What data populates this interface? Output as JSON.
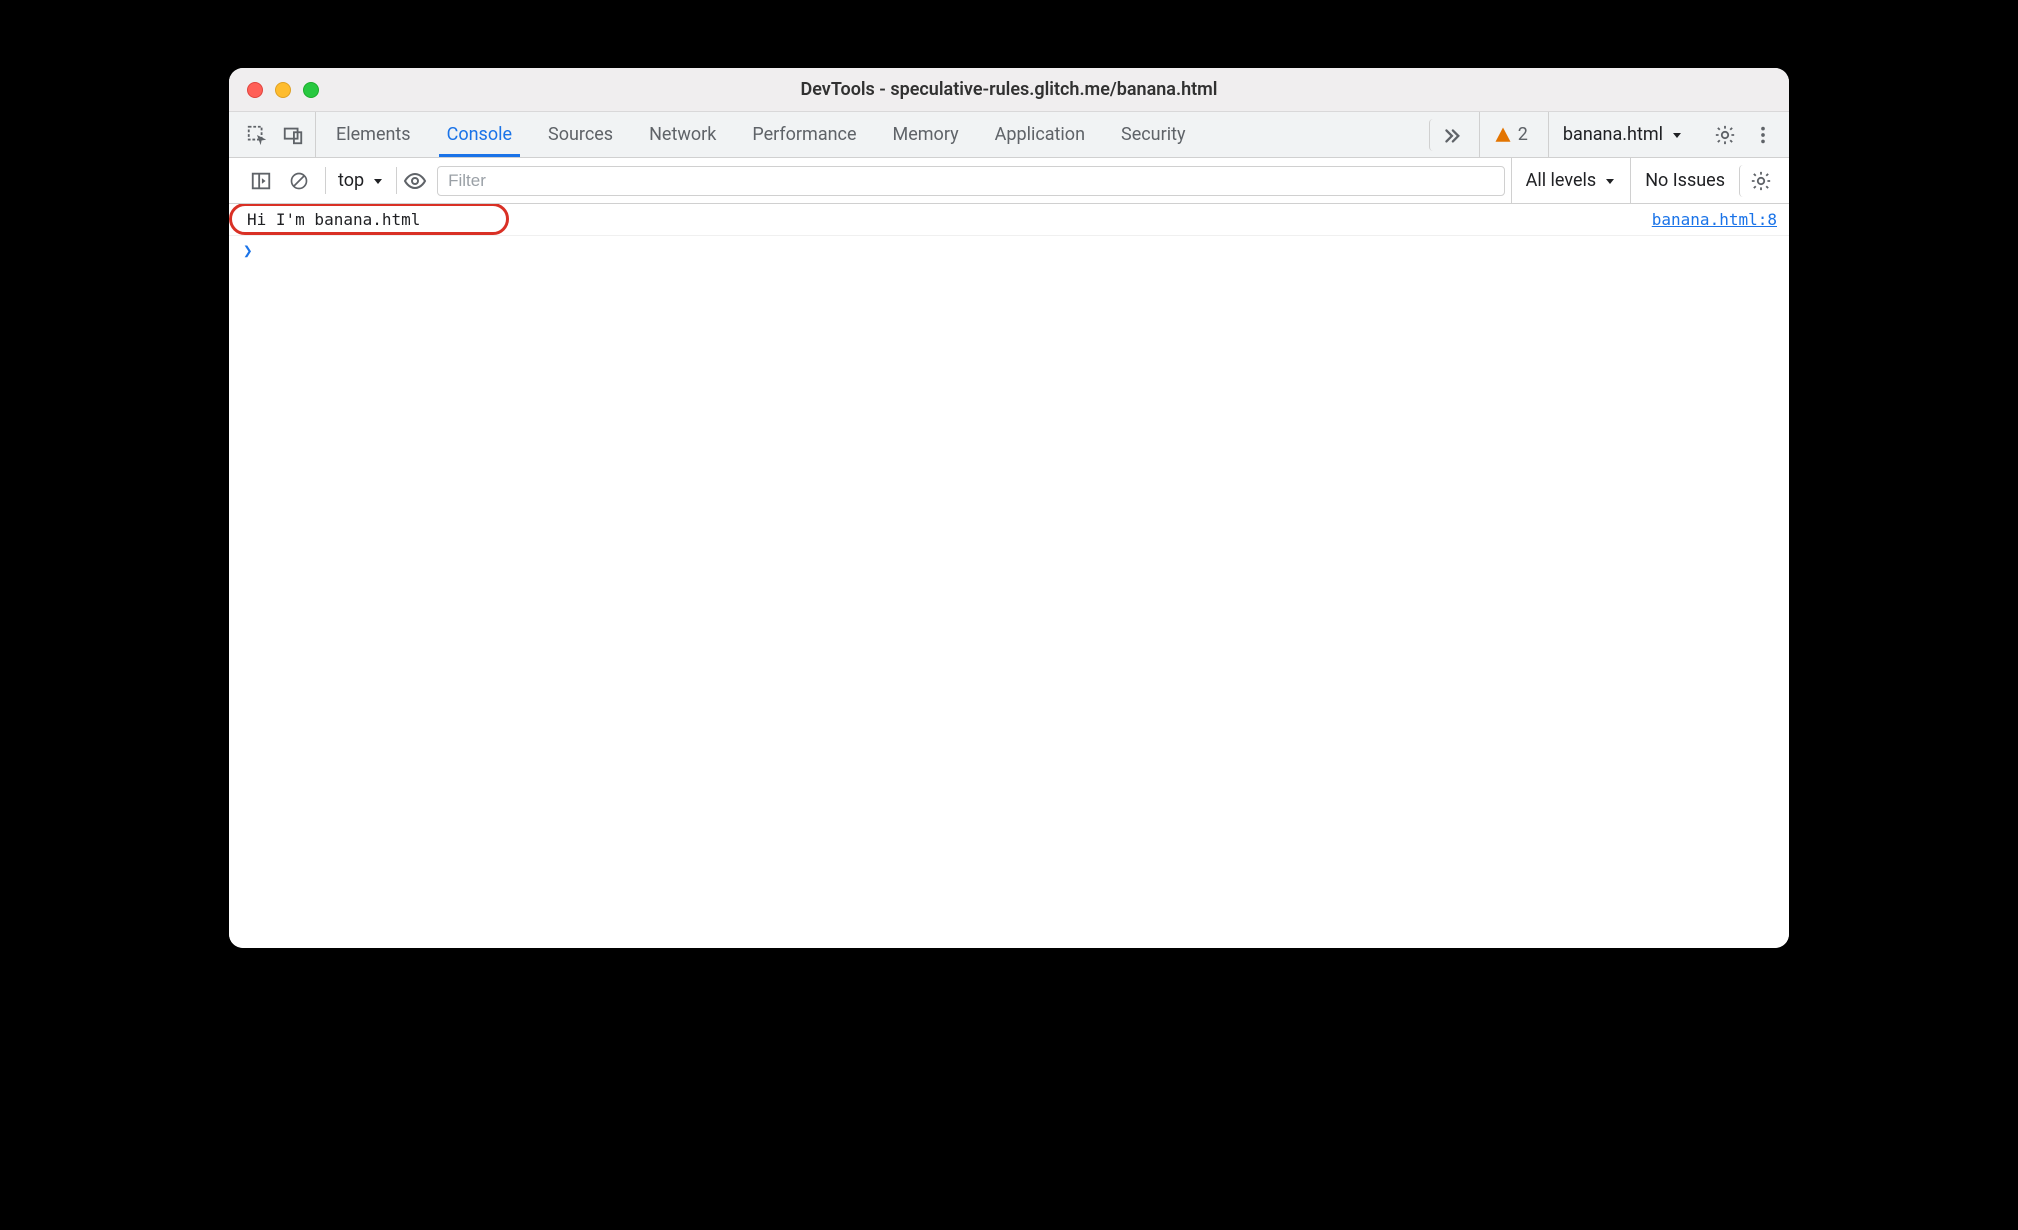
{
  "window": {
    "title": "DevTools - speculative-rules.glitch.me/banana.html"
  },
  "tabs": {
    "elements": "Elements",
    "console": "Console",
    "sources": "Sources",
    "network": "Network",
    "performance": "Performance",
    "memory": "Memory",
    "application": "Application",
    "security": "Security"
  },
  "warnings": {
    "count": "2"
  },
  "target": {
    "label": "banana.html"
  },
  "toolbar": {
    "context": "top",
    "filter_placeholder": "Filter",
    "levels_label": "All levels",
    "issues_label": "No Issues"
  },
  "console": {
    "log_message": "Hi I'm banana.html",
    "log_source": "banana.html:8",
    "prompt": ""
  }
}
